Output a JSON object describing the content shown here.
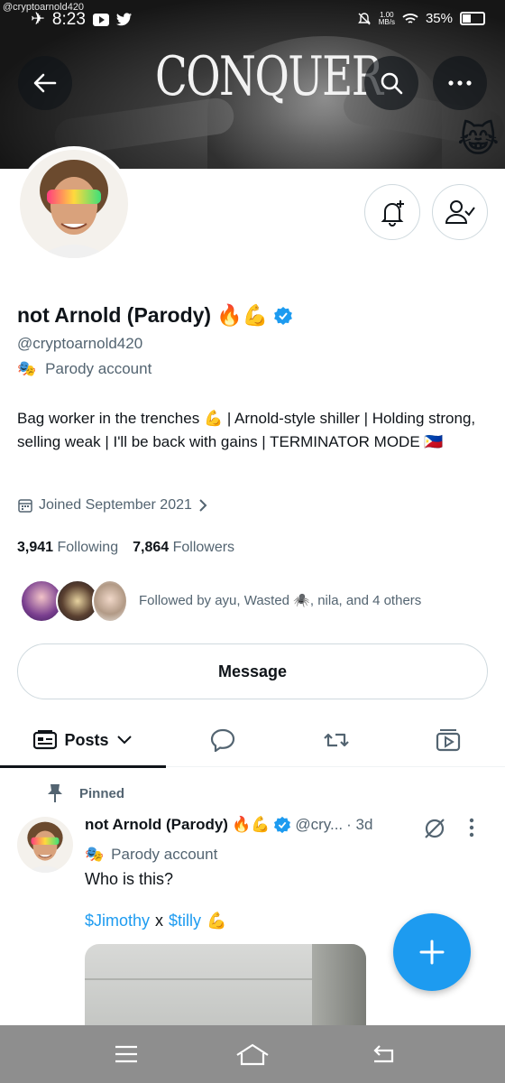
{
  "status_bar": {
    "watermark": "@cryptoarnold420",
    "time": "8:23",
    "speed_value": "1.00",
    "speed_unit": "MB/s",
    "battery": "35%"
  },
  "banner": {
    "title": "CONQUER"
  },
  "profile": {
    "name": "not Arnold (Parody)",
    "name_emojis": "🔥💪",
    "handle": "@cryptoarnold420",
    "parody_label": "Parody account",
    "bio": "Bag worker in the trenches 💪 | Arnold-style shiller | Holding strong, selling weak | I'll be back with gains | TERMINATOR MODE 🇵🇭",
    "joined": "Joined September 2021",
    "following_count": "3,941",
    "following_label": "Following",
    "followers_count": "7,864",
    "followers_label": "Followers",
    "followed_by": "Followed by ayu, Wasted 🕷️, nila, and 4 others",
    "message_label": "Message"
  },
  "tabs": {
    "posts_label": "Posts"
  },
  "post": {
    "pinned_label": "Pinned",
    "author_name": "not Arnold (Parody)",
    "author_emojis": "🔥💪",
    "author_handle": "@cry...",
    "time": "· 3d",
    "parody_label": "Parody account",
    "text": "Who is this?",
    "cashtag_1": "$Jimothy",
    "separator": "x",
    "cashtag_2": "$tilly",
    "tags_emoji": "💪"
  },
  "colors": {
    "accent": "#1d9bf0",
    "secondary_text": "#536471",
    "border": "#cfd9de"
  }
}
